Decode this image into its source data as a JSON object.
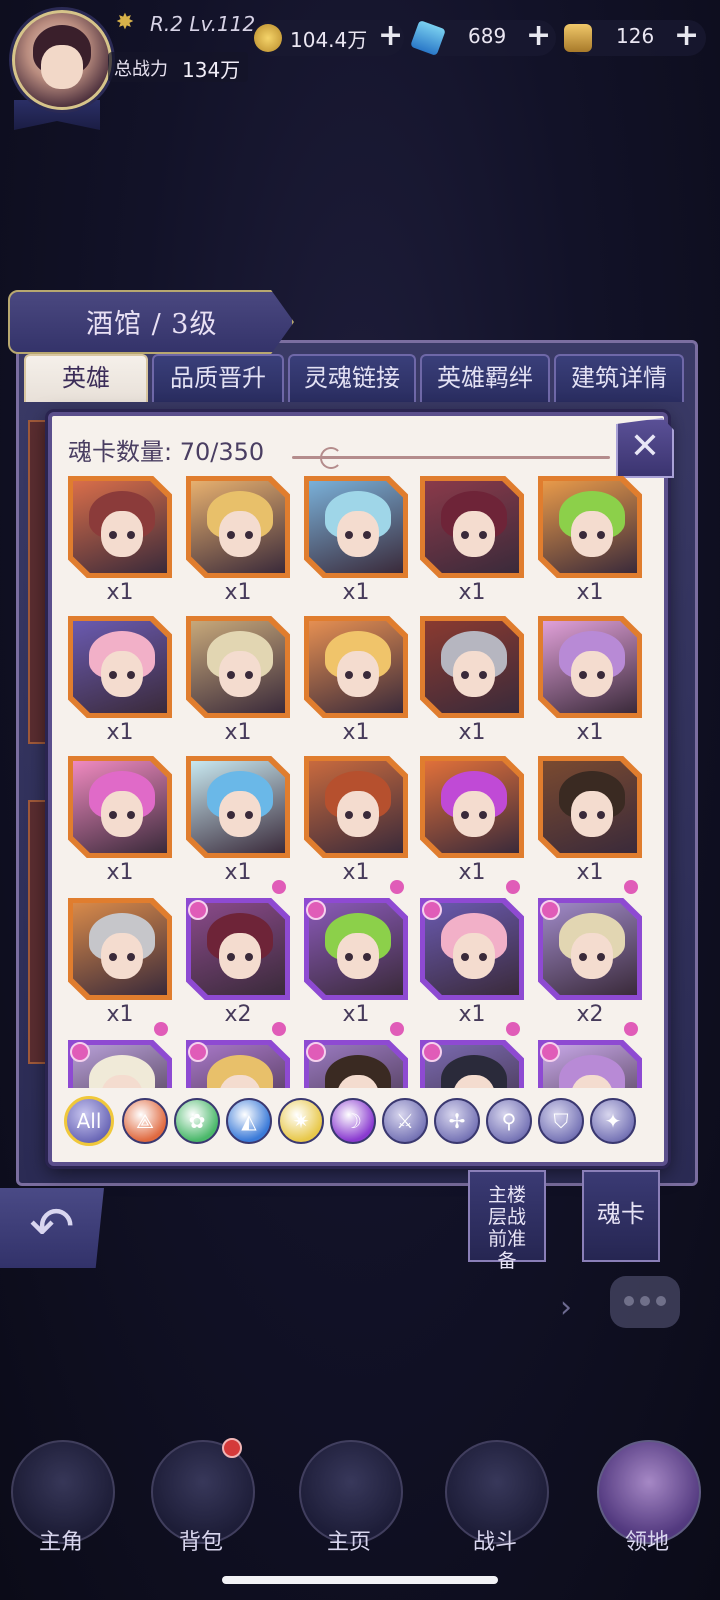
{
  "player": {
    "rank_level": "R.2 Lv.112",
    "power_label": "总战力",
    "power_value": "134万"
  },
  "resources": [
    {
      "name": "gold",
      "icon": "gold-coin-icon",
      "value": "104.4万"
    },
    {
      "name": "crystal",
      "icon": "blue-crystal-icon",
      "value": "689"
    },
    {
      "name": "ticket",
      "icon": "gold-ticket-icon",
      "value": "126"
    }
  ],
  "building": {
    "title": "酒馆 / 3级",
    "tabs": [
      "英雄",
      "品质晋升",
      "灵魂链接",
      "英雄羁绊",
      "建筑详情"
    ],
    "active_tab": 0
  },
  "dialog": {
    "title": "魂卡数量: 70/350",
    "close_icon": "crossed-swords-close-icon",
    "cards": [
      {
        "count": "x1",
        "rarity": "orange",
        "hair": "#8b3b3a",
        "bg": "#d96e4a"
      },
      {
        "count": "x1",
        "rarity": "orange",
        "hair": "#e8c06a",
        "bg": "#e7b06f"
      },
      {
        "count": "x1",
        "rarity": "orange",
        "hair": "#9fd6e8",
        "bg": "#7ab0d8"
      },
      {
        "count": "x1",
        "rarity": "orange",
        "hair": "#6e2438",
        "bg": "#8a3a4a"
      },
      {
        "count": "x1",
        "rarity": "orange",
        "hair": "#8cd04a",
        "bg": "#e89a4a"
      },
      {
        "count": "x1",
        "rarity": "orange",
        "hair": "#f2b0c8",
        "bg": "#6a5ab0"
      },
      {
        "count": "x1",
        "rarity": "orange",
        "hair": "#e2d6b2",
        "bg": "#c7a87a"
      },
      {
        "count": "x1",
        "rarity": "orange",
        "hair": "#f0c46a",
        "bg": "#e58f52"
      },
      {
        "count": "x1",
        "rarity": "orange",
        "hair": "#b6b6c0",
        "bg": "#8a3a30"
      },
      {
        "count": "x1",
        "rarity": "orange",
        "hair": "#b88ad6",
        "bg": "#e0a0d8"
      },
      {
        "count": "x1",
        "rarity": "orange",
        "hair": "#e06ac8",
        "bg": "#f08ac0"
      },
      {
        "count": "x1",
        "rarity": "orange",
        "hair": "#6ab8e8",
        "bg": "#c8e8f0"
      },
      {
        "count": "x1",
        "rarity": "orange",
        "hair": "#b6502e",
        "bg": "#c86a3e"
      },
      {
        "count": "x1",
        "rarity": "orange",
        "hair": "#c04ad6",
        "bg": "#e0703a"
      },
      {
        "count": "x1",
        "rarity": "orange",
        "hair": "#3a2a22",
        "bg": "#7a4a30"
      },
      {
        "count": "x1",
        "rarity": "orange",
        "hair": "#c6c6ca",
        "bg": "#d88a4a"
      },
      {
        "count": "x2",
        "rarity": "purple",
        "hair": "#6e2438",
        "bg": "#8a4a8a"
      },
      {
        "count": "x1",
        "rarity": "purple",
        "hair": "#8cd04a",
        "bg": "#8a5ab8"
      },
      {
        "count": "x1",
        "rarity": "purple",
        "hair": "#f2b0c8",
        "bg": "#6a5ab0"
      },
      {
        "count": "x2",
        "rarity": "purple",
        "hair": "#e2d6b2",
        "bg": "#a08ac8"
      },
      {
        "count": "",
        "rarity": "purple",
        "hair": "#f0ead8",
        "bg": "#b8a0d8"
      },
      {
        "count": "",
        "rarity": "purple",
        "hair": "#e8c06a",
        "bg": "#a878c8"
      },
      {
        "count": "",
        "rarity": "purple",
        "hair": "#3a2a22",
        "bg": "#9a7ac0"
      },
      {
        "count": "",
        "rarity": "purple",
        "hair": "#2a2a3a",
        "bg": "#7a6ab0"
      },
      {
        "count": "",
        "rarity": "purple",
        "hair": "#b88ad6",
        "bg": "#c8a8e8"
      }
    ],
    "filters": [
      {
        "name": "all",
        "label": "All",
        "icon": "all-icon",
        "color": "#7a78c8"
      },
      {
        "name": "fire",
        "label": "",
        "icon": "fire-element-icon",
        "color": "#e06a40"
      },
      {
        "name": "wind",
        "label": "",
        "icon": "wind-element-icon",
        "color": "#4ab86a"
      },
      {
        "name": "water",
        "label": "",
        "icon": "water-element-icon",
        "color": "#3a7ad8"
      },
      {
        "name": "light",
        "label": "",
        "icon": "light-element-icon",
        "color": "#e8c84a"
      },
      {
        "name": "dark",
        "label": "",
        "icon": "dark-element-icon",
        "color": "#8a3ad0"
      },
      {
        "name": "warrior",
        "label": "",
        "icon": "sword-class-icon",
        "color": "#7a78b8"
      },
      {
        "name": "assassin",
        "label": "",
        "icon": "shuriken-class-icon",
        "color": "#7a78b8"
      },
      {
        "name": "mage",
        "label": "",
        "icon": "staff-class-icon",
        "color": "#7a78b8"
      },
      {
        "name": "tank",
        "label": "",
        "icon": "shield-class-icon",
        "color": "#7a78b8"
      },
      {
        "name": "support",
        "label": "",
        "icon": "wings-class-icon",
        "color": "#7a78b8"
      }
    ]
  },
  "side_buttons": {
    "prepare": "主楼层战前准备",
    "soul_card": "魂卡"
  },
  "nav": [
    {
      "label": "主角",
      "icon": "hero-hood-icon"
    },
    {
      "label": "背包",
      "icon": "backpack-icon"
    },
    {
      "label": "主页",
      "icon": "book-home-icon"
    },
    {
      "label": "战斗",
      "icon": "crossed-swords-icon"
    },
    {
      "label": "领地",
      "icon": "castle-icon"
    }
  ],
  "colors": {
    "orange_frame": "#e07d2e",
    "purple_frame": "#8e4ad2",
    "notification": "#d43a3a"
  }
}
